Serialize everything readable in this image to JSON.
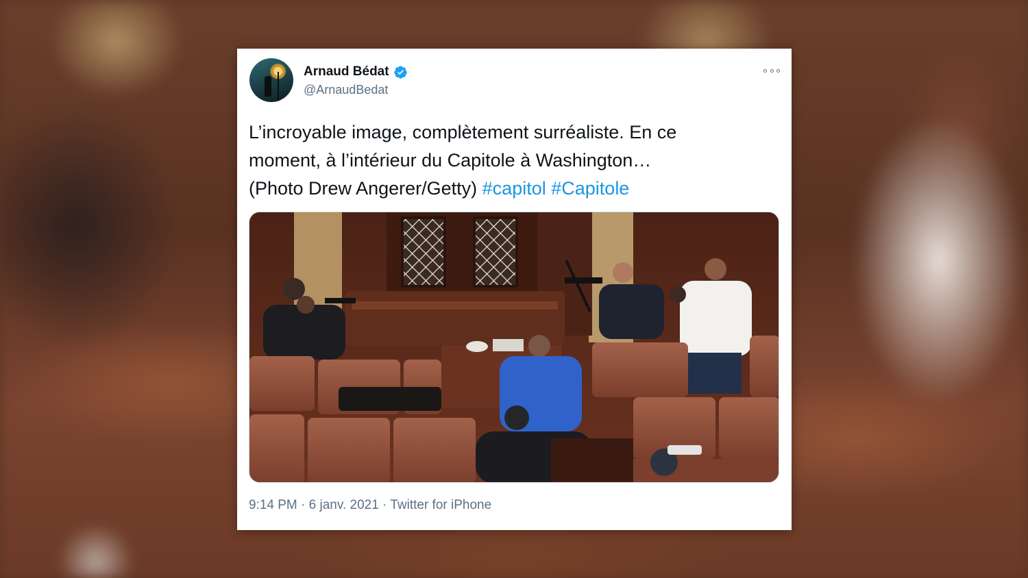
{
  "tweet": {
    "author_name": "Arnaud Bédat",
    "handle": "@ArnaudBedat",
    "text_line1": "L’incroyable image, complètement surréaliste. En ce",
    "text_line2": "moment, à l’intérieur du Capitole à Washington…",
    "text_line3_prefix": "(Photo Drew Angerer/Getty)",
    "hashtags": [
      "#capitol",
      "#Capitole"
    ],
    "time": "9:14 PM",
    "date": "6 janv. 2021",
    "client": "Twitter for iPhone",
    "separator": " · "
  },
  "icons": {
    "verified": "verified-badge-icon",
    "more": "more-options-icon"
  },
  "colors": {
    "link": "#1b95e0",
    "verified": "#1da1f2",
    "secondary_text": "#5b7083",
    "primary_text": "#0f1419"
  }
}
